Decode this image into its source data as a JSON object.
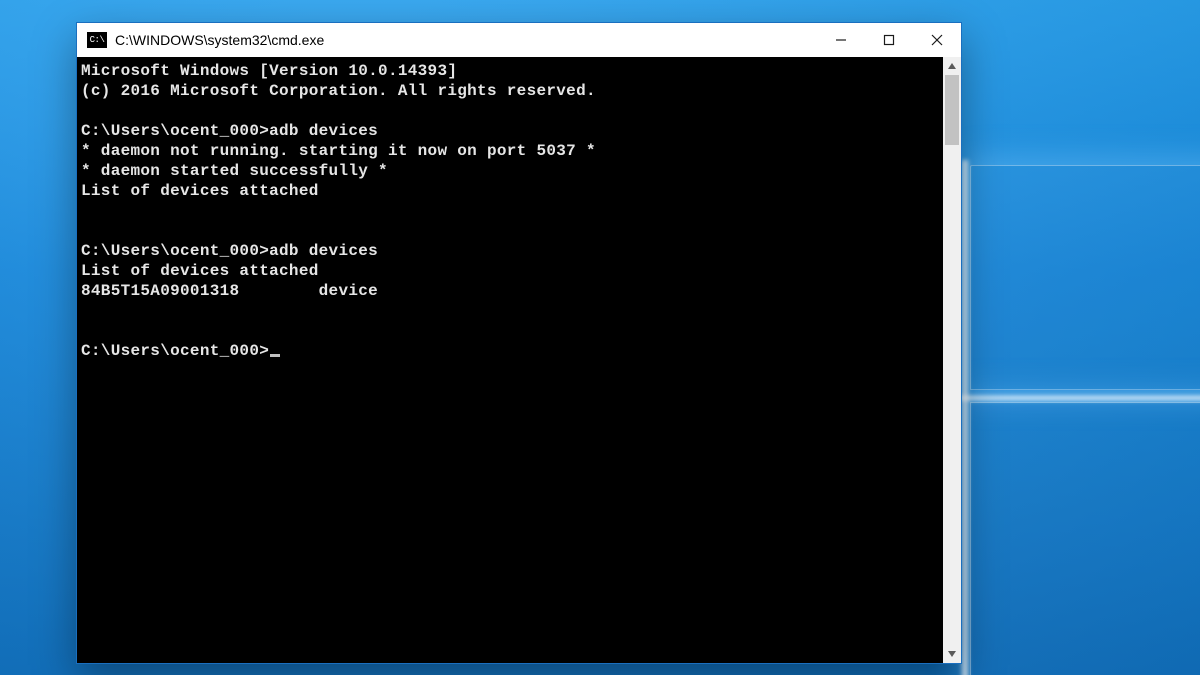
{
  "window": {
    "title": "C:\\WINDOWS\\system32\\cmd.exe",
    "icon_name": "cmd-icon",
    "controls": {
      "minimize": "Minimize",
      "maximize": "Maximize",
      "close": "Close"
    }
  },
  "terminal": {
    "lines": [
      "Microsoft Windows [Version 10.0.14393]",
      "(c) 2016 Microsoft Corporation. All rights reserved.",
      "",
      "C:\\Users\\ocent_000>adb devices",
      "* daemon not running. starting it now on port 5037 *",
      "* daemon started successfully *",
      "List of devices attached",
      "",
      "",
      "C:\\Users\\ocent_000>adb devices",
      "List of devices attached",
      "84B5T15A09001318        device",
      "",
      "",
      "C:\\Users\\ocent_000>"
    ],
    "prompt_index": 14
  },
  "colors": {
    "window_border": "#1a6fbf",
    "terminal_bg": "#000000",
    "terminal_fg": "#c0c0c0",
    "desktop_top": "#1f9ff2",
    "desktop_bottom": "#0870c4"
  }
}
